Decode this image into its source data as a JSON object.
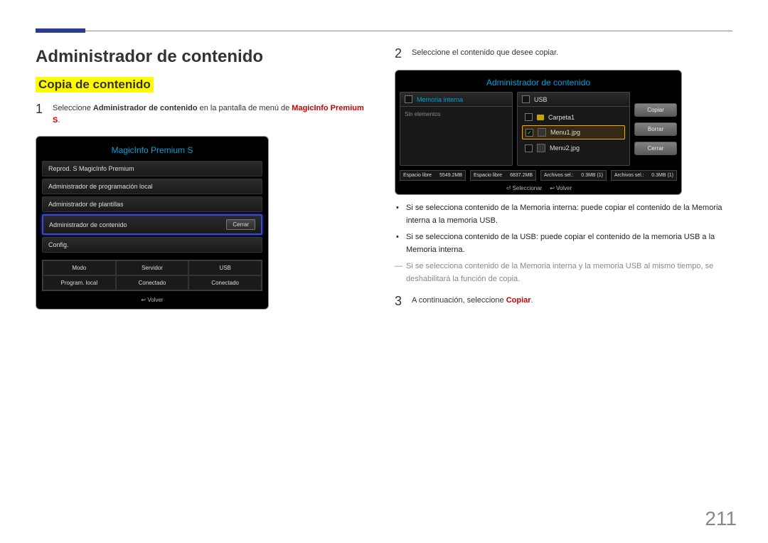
{
  "page_number": "211",
  "heading": "Administrador de contenido",
  "subheading": "Copia de contenido",
  "steps": {
    "1": {
      "num": "1",
      "text_pre": "Seleccione ",
      "bold1": "Administrador de contenido",
      "text_mid": " en la pantalla de menú de ",
      "red1": "MagicInfo Premium S",
      "text_end": "."
    },
    "2": {
      "num": "2",
      "text": "Seleccione el contenido que desee copiar."
    },
    "3": {
      "num": "3",
      "text_pre": "A continuación, seleccione ",
      "red1": "Copiar",
      "text_end": "."
    }
  },
  "bullets": {
    "b1": {
      "t1": "Si se selecciona contenido de la ",
      "bold1": "Memoria interna",
      "t2": ": puede copiar el contenido de la ",
      "bold_red1": "Memoria interna",
      "t3": " a la memoria ",
      "bold_red2": "USB",
      "t4": "."
    },
    "b2": {
      "t1": "Si se selecciona contenido de la ",
      "bold1": "USB",
      "t2": ": puede copiar el contenido de la memoria ",
      "bold_red1": "USB",
      "t3": " a la ",
      "bold_red2": "Memoria interna",
      "t4": "."
    }
  },
  "note": {
    "t1": "Si se selecciona contenido de la ",
    "bold1": "Memoria interna",
    "t2": " y la memoria ",
    "bold2": "USB",
    "t3": " al mismo tiempo, se deshabilitará la función de copia."
  },
  "mock1": {
    "title": "MagicInfo Premium S",
    "items": {
      "0": "Reprod. S MagicInfo Premium",
      "1": "Administrador de programación local",
      "2": "Administrador de plantillas",
      "3": "Administrador de contenido",
      "3_btn": "Cerrar",
      "4": "Config."
    },
    "table": {
      "h0": "Modo",
      "h1": "Servidor",
      "h2": "USB",
      "v0": "Program. local",
      "v1": "Conectado",
      "v2": "Conectado"
    },
    "footer": "Volver"
  },
  "mock2": {
    "title": "Administrador de contenido",
    "panelA_header": "Memoria interna",
    "panelA_empty": "Sin elementos",
    "panelB_header": "USB",
    "files": {
      "folder": "Carpeta1",
      "f1": "Menu1.jpg",
      "f2": "Menu2.jpg"
    },
    "side": {
      "copy": "Copiar",
      "delete": "Borrar",
      "close": "Cerrar"
    },
    "stats": {
      "a_free_l": "Espacio libre",
      "a_free_v": "5549.2MB",
      "a_sel_l": "Archivos sel.:",
      "a_sel_v": "0.3MB (1)",
      "b_free_l": "Espacio libre",
      "b_free_v": "6837.2MB",
      "b_sel_l": "Archivos sel.:",
      "b_sel_v": "0.3MB (1)"
    },
    "footer_select": "Seleccionar",
    "footer_back": "Volver"
  }
}
